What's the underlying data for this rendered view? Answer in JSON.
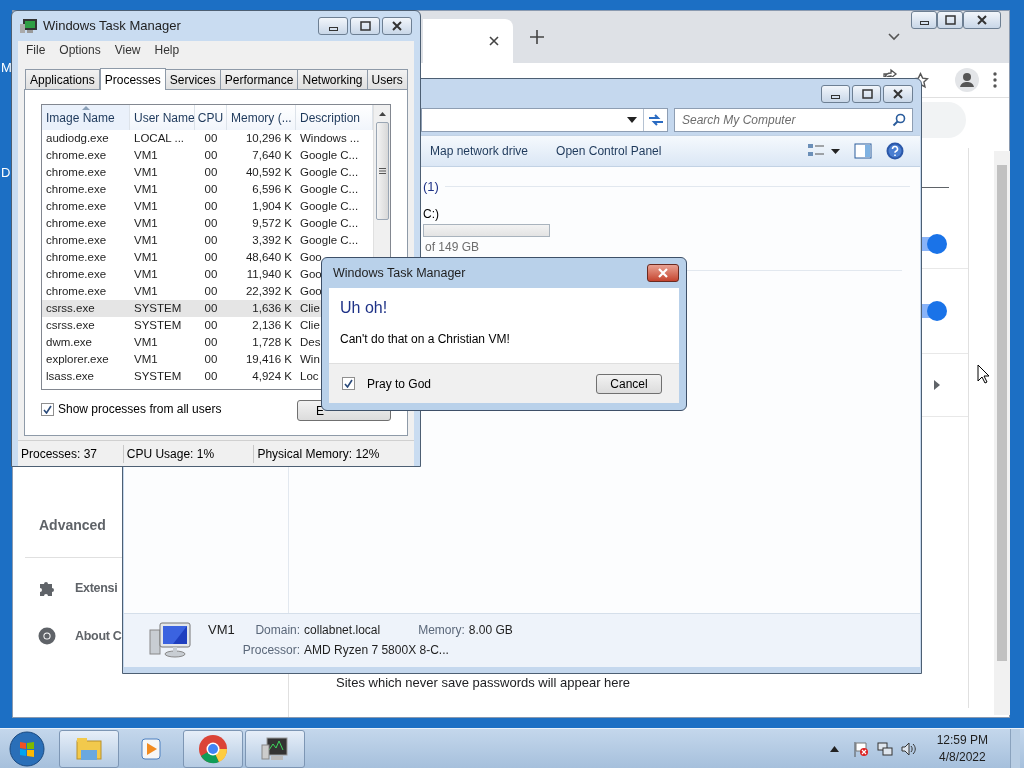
{
  "desktop": {
    "icon_labels": [
      "M",
      "D"
    ]
  },
  "browser": {
    "toggles": [
      {
        "on": true
      },
      {
        "on": true
      }
    ],
    "sidebar": [
      {
        "kind": "heading",
        "label": "Advanced"
      },
      {
        "kind": "extensions",
        "label": "Extensi"
      },
      {
        "kind": "about",
        "label": "About C"
      }
    ],
    "empty_message": "Sites which never save passwords will appear here"
  },
  "explorer": {
    "search": {
      "placeholder": "Search My Computer"
    },
    "toolbar": [
      "Map network drive",
      "Open Control Panel"
    ],
    "group_count": "(1)",
    "drive": {
      "name": "C:)",
      "size": "of 149 GB"
    },
    "details": {
      "computer_name": "VM1",
      "fields": [
        {
          "label": "Domain:",
          "value": "collabnet.local"
        },
        {
          "label": "Memory:",
          "value": "8.00 GB"
        },
        {
          "label": "Processor:",
          "value": "AMD Ryzen 7 5800X 8-C..."
        }
      ]
    }
  },
  "task_manager": {
    "title": "Windows Task Manager",
    "menu": [
      "File",
      "Options",
      "View",
      "Help"
    ],
    "tabs": [
      {
        "label": "Applications",
        "selected": false
      },
      {
        "label": "Processes",
        "selected": true
      },
      {
        "label": "Services",
        "selected": false
      },
      {
        "label": "Performance",
        "selected": false
      },
      {
        "label": "Networking",
        "selected": false
      },
      {
        "label": "Users",
        "selected": false
      }
    ],
    "columns": [
      {
        "label": "Image Name",
        "sorted": true
      },
      {
        "label": "User Name",
        "sorted": false
      },
      {
        "label": "CPU",
        "sorted": false
      },
      {
        "label": "Memory (...",
        "sorted": false
      },
      {
        "label": "Description",
        "sorted": false
      }
    ],
    "rows": [
      {
        "cells": [
          "audiodg.exe",
          "LOCAL ...",
          "00",
          "10,296 K",
          "Windows ..."
        ],
        "selected": false
      },
      {
        "cells": [
          "chrome.exe",
          "VM1",
          "00",
          "7,640 K",
          "Google C..."
        ],
        "selected": false
      },
      {
        "cells": [
          "chrome.exe",
          "VM1",
          "00",
          "40,592 K",
          "Google C..."
        ],
        "selected": false
      },
      {
        "cells": [
          "chrome.exe",
          "VM1",
          "00",
          "6,596 K",
          "Google C..."
        ],
        "selected": false
      },
      {
        "cells": [
          "chrome.exe",
          "VM1",
          "00",
          "1,904 K",
          "Google C..."
        ],
        "selected": false
      },
      {
        "cells": [
          "chrome.exe",
          "VM1",
          "00",
          "9,572 K",
          "Google C..."
        ],
        "selected": false
      },
      {
        "cells": [
          "chrome.exe",
          "VM1",
          "00",
          "3,392 K",
          "Google C..."
        ],
        "selected": false
      },
      {
        "cells": [
          "chrome.exe",
          "VM1",
          "00",
          "48,640 K",
          "Goo"
        ],
        "selected": false
      },
      {
        "cells": [
          "chrome.exe",
          "VM1",
          "00",
          "11,940 K",
          "Goo"
        ],
        "selected": false
      },
      {
        "cells": [
          "chrome.exe",
          "VM1",
          "00",
          "22,392 K",
          "Goo"
        ],
        "selected": false
      },
      {
        "cells": [
          "csrss.exe",
          "SYSTEM",
          "00",
          "1,636 K",
          "Clie"
        ],
        "selected": true
      },
      {
        "cells": [
          "csrss.exe",
          "SYSTEM",
          "00",
          "2,136 K",
          "Clie"
        ],
        "selected": false
      },
      {
        "cells": [
          "dwm.exe",
          "VM1",
          "00",
          "1,728 K",
          "Des"
        ],
        "selected": false
      },
      {
        "cells": [
          "explorer.exe",
          "VM1",
          "00",
          "19,416 K",
          "Win"
        ],
        "selected": false
      },
      {
        "cells": [
          "lsass.exe",
          "SYSTEM",
          "00",
          "4,924 K",
          "Loc"
        ],
        "selected": false
      }
    ],
    "show_all_users": {
      "label": "Show processes from all users",
      "checked": true
    },
    "end_button": "E",
    "status": [
      "Processes: 37",
      "CPU Usage: 1%",
      "Physical Memory: 12%"
    ]
  },
  "dialog": {
    "title": "Windows Task Manager",
    "heading": "Uh oh!",
    "message": "Can't do that on a Christian VM!",
    "checkbox": {
      "label": "Pray to God",
      "checked": true
    },
    "button": "Cancel"
  },
  "taskbar": {
    "buttons": [
      {
        "kind": "explorer",
        "running": true
      },
      {
        "kind": "media",
        "running": false
      },
      {
        "kind": "chrome",
        "running": true
      },
      {
        "kind": "taskmgr",
        "running": true
      }
    ],
    "clock": {
      "time": "12:59 PM",
      "date": "4/8/2022"
    }
  }
}
